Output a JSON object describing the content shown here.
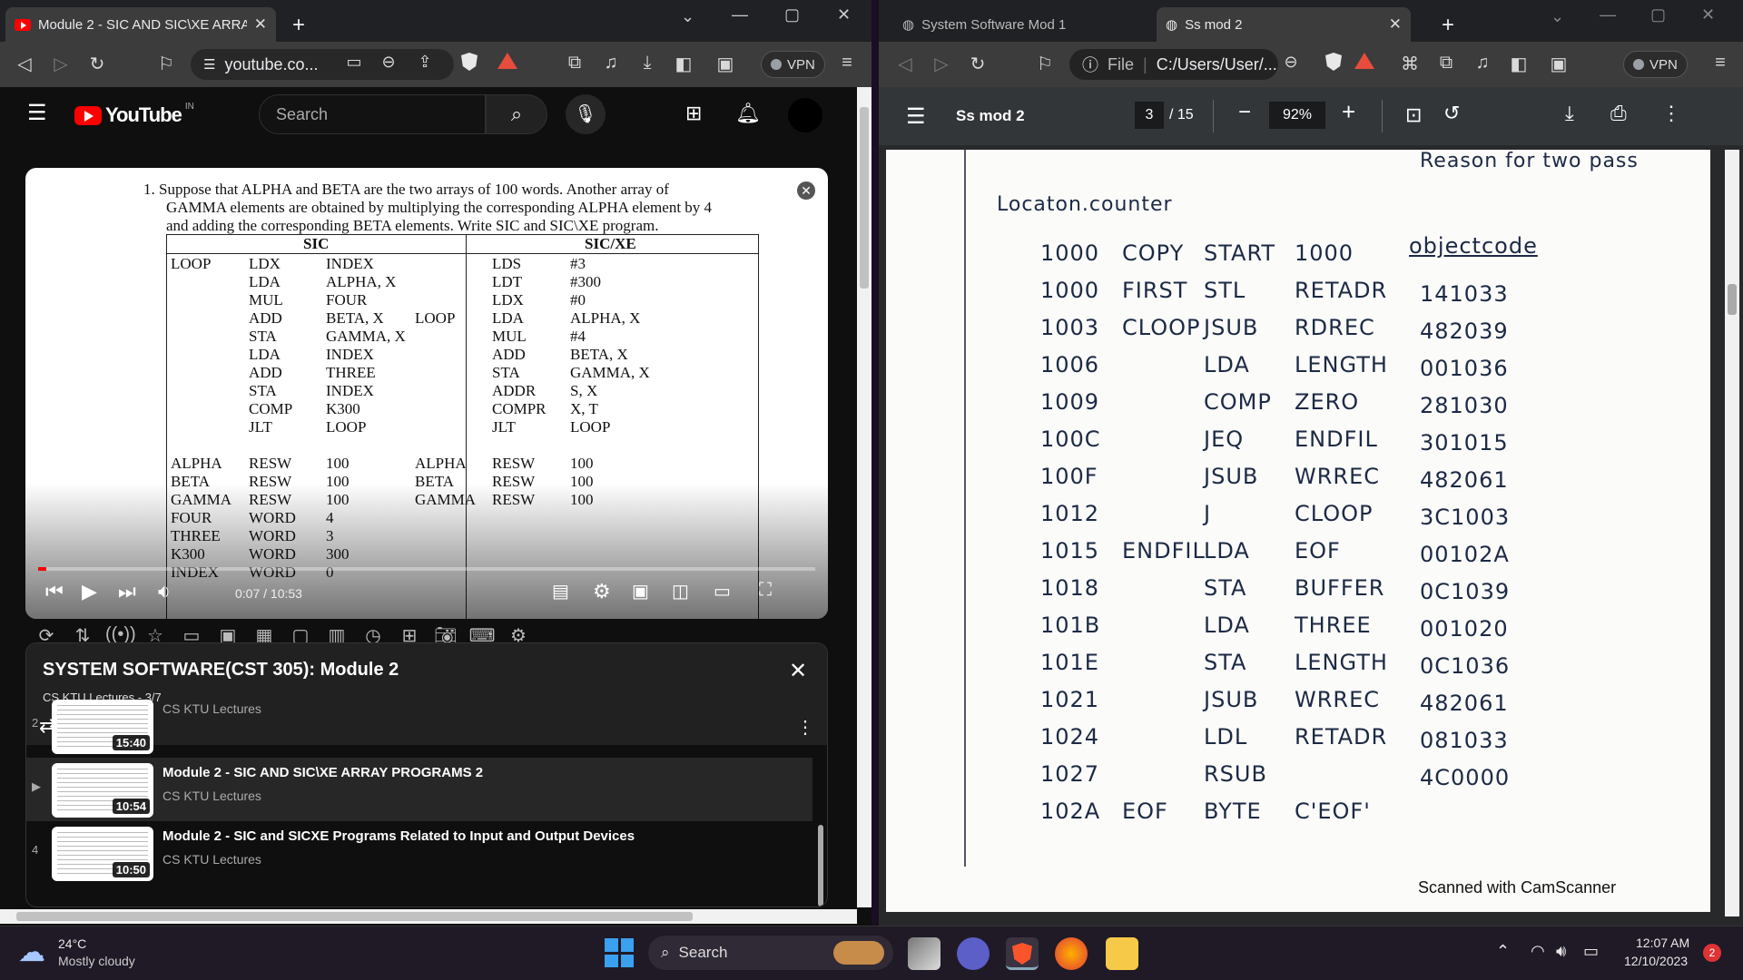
{
  "left_browser": {
    "tab_title": "Module 2 - SIC AND SIC\\XE ARRA",
    "url": "youtube.co...",
    "vpn_label": "VPN"
  },
  "youtube": {
    "logo_text": "YouTube",
    "logo_region": "IN",
    "search_placeholder": "Search",
    "video": {
      "question_lines": [
        "1.  Suppose that ALPHA and BETA are the two arrays of 100 words. Another array of",
        "GAMMA elements are obtained by multiplying the corresponding ALPHA element by 4",
        "and adding the corresponding BETA elements. Write SIC and SIC\\XE program."
      ],
      "sic_header": "SIC",
      "sicxe_header": "SIC/XE",
      "sic_col1": [
        "LOOP",
        "",
        "",
        "",
        "",
        "",
        "",
        "",
        "",
        "",
        "ALPHA",
        "BETA",
        "GAMMA",
        "FOUR",
        "THREE",
        "K300",
        "INDEX"
      ],
      "sic_col2": [
        "LDX",
        "LDA",
        "MUL",
        "ADD",
        "STA",
        "LDA",
        "ADD",
        "STA",
        "COMP",
        "JLT",
        "RESW",
        "RESW",
        "RESW",
        "WORD",
        "WORD",
        "WORD",
        "WORD"
      ],
      "sic_col3": [
        "INDEX",
        "ALPHA, X",
        "FOUR",
        "BETA, X",
        "GAMMA, X",
        "INDEX",
        "THREE",
        "INDEX",
        "K300",
        "LOOP",
        "100",
        "100",
        "100",
        "4",
        "3",
        "300",
        "0"
      ],
      "xe_col1": [
        "",
        "",
        "",
        "LOOP",
        "",
        "",
        "",
        "",
        "",
        "",
        "ALPHA",
        "BETA",
        "GAMMA",
        "",
        "",
        "",
        ""
      ],
      "xe_col2": [
        "LDS",
        "LDT",
        "LDX",
        "LDA",
        "MUL",
        "ADD",
        "STA",
        "ADDR",
        "COMPR",
        "JLT",
        "RESW",
        "RESW",
        "RESW",
        "",
        "",
        "",
        ""
      ],
      "xe_col3": [
        "#3",
        "#300",
        "#0",
        "ALPHA, X",
        "#4",
        "BETA, X",
        "GAMMA, X",
        "S, X",
        "X, T",
        "LOOP",
        "100",
        "100",
        "100",
        "",
        "",
        "",
        ""
      ],
      "time": "0:07 / 10:53",
      "progress_fraction": 0.011
    },
    "playlist": {
      "title": "SYSTEM SOFTWARE(CST 305): Module 2",
      "channel_pos": "CS KTU Lectures - 3/7",
      "items": [
        {
          "index": "2",
          "title": "",
          "channel": "CS KTU Lectures",
          "duration": "15:40"
        },
        {
          "index": "▶",
          "title": "Module 2 - SIC AND SIC\\XE ARRAY PROGRAMS 2",
          "channel": "CS KTU Lectures",
          "duration": "10:54"
        },
        {
          "index": "4",
          "title": "Module 2 - SIC and SICXE Programs Related to Input and Output Devices",
          "channel": "CS KTU Lectures",
          "duration": "10:50"
        }
      ]
    }
  },
  "right_browser": {
    "tab1_title": "System Software Mod 1",
    "tab2_title": "Ss mod 2",
    "url_prefix": "File",
    "url": "C:/Users/User/...",
    "vpn_label": "VPN",
    "pdf": {
      "doc_title": "Ss mod 2",
      "page_current": "3",
      "page_total": "/ 15",
      "zoom": "92%",
      "footer": "Scanned with CamScanner",
      "top_note": "Reason for two pass",
      "heading": "Locaton.counter",
      "object_header": "objectcode",
      "rows": [
        {
          "loc": "1000",
          "label": "COPY",
          "op": "START",
          "operand": "1000",
          "obj": ""
        },
        {
          "loc": "1000",
          "label": "FIRST",
          "op": "STL",
          "operand": "RETADR",
          "obj": "141033"
        },
        {
          "loc": "1003",
          "label": "CLOOP",
          "op": "JSUB",
          "operand": "RDREC",
          "obj": "482039"
        },
        {
          "loc": "1006",
          "label": "",
          "op": "LDA",
          "operand": "LENGTH",
          "obj": "001036"
        },
        {
          "loc": "1009",
          "label": "",
          "op": "COMP",
          "operand": "ZERO",
          "obj": "281030"
        },
        {
          "loc": "100C",
          "label": "",
          "op": "JEQ",
          "operand": "ENDFIL",
          "obj": "301015"
        },
        {
          "loc": "100F",
          "label": "",
          "op": "JSUB",
          "operand": "WRREC",
          "obj": "482061"
        },
        {
          "loc": "1012",
          "label": "",
          "op": "J",
          "operand": "CLOOP",
          "obj": "3C1003"
        },
        {
          "loc": "1015",
          "label": "ENDFIL",
          "op": "LDA",
          "operand": "EOF",
          "obj": "00102A"
        },
        {
          "loc": "1018",
          "label": "",
          "op": "STA",
          "operand": "BUFFER",
          "obj": "0C1039"
        },
        {
          "loc": "101B",
          "label": "",
          "op": "LDA",
          "operand": "THREE",
          "obj": "001020"
        },
        {
          "loc": "101E",
          "label": "",
          "op": "STA",
          "operand": "LENGTH",
          "obj": "0C1036"
        },
        {
          "loc": "1021",
          "label": "",
          "op": "JSUB",
          "operand": "WRREC",
          "obj": "482061"
        },
        {
          "loc": "1024",
          "label": "",
          "op": "LDL",
          "operand": "RETADR",
          "obj": "081033"
        },
        {
          "loc": "1027",
          "label": "",
          "op": "RSUB",
          "operand": "",
          "obj": "4C0000"
        },
        {
          "loc": "102A",
          "label": "EOF",
          "op": "BYTE",
          "operand": "C'EOF'",
          "obj": ""
        }
      ]
    }
  },
  "taskbar": {
    "temp": "24°C",
    "weather": "Mostly cloudy",
    "search": "Search",
    "time": "12:07 AM",
    "date": "12/10/2023",
    "notif_count": "2"
  }
}
